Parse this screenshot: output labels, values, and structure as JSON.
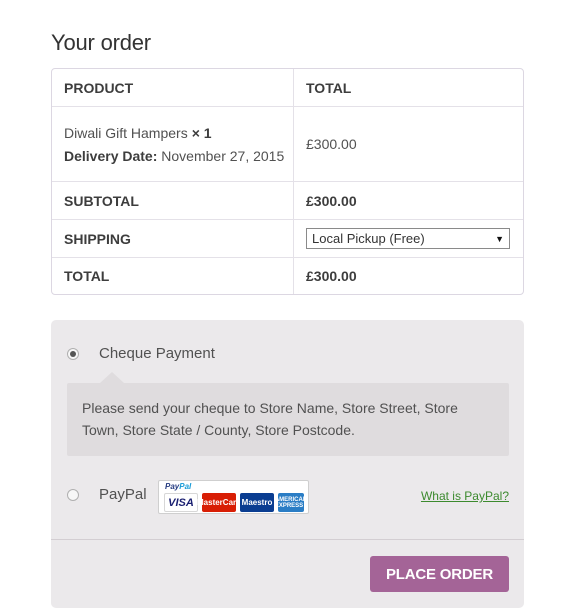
{
  "heading": "Your order",
  "table": {
    "col_product": "PRODUCT",
    "col_total": "TOTAL",
    "item": {
      "name": "Diwali Gift Hampers",
      "qty": "× 1",
      "delivery_label": "Delivery Date:",
      "delivery_value": "November 27, 2015",
      "total": "£300.00"
    },
    "subtotal_label": "SUBTOTAL",
    "subtotal_value": "£300.00",
    "shipping_label": "SHIPPING",
    "shipping_selected": "Local Pickup (Free)",
    "total_label": "TOTAL",
    "total_value": "£300.00"
  },
  "payment": {
    "cheque_label": "Cheque Payment",
    "cheque_selected": true,
    "cheque_description": "Please send your cheque to Store Name, Store Street, Store Town, Store State / County, Store Postcode.",
    "paypal_label": "PayPal",
    "paypal_logo": {
      "brand_pay": "Pay",
      "brand_pal": "Pal",
      "cards": [
        "VISA",
        "MasterCard",
        "Maestro",
        "AMERICAN EXPRESS"
      ]
    },
    "what_is_paypal": "What is PayPal?",
    "place_order": "PLACE ORDER"
  },
  "colors": {
    "accent_button": "#a46497",
    "payment_bg": "#ebe9eb",
    "link": "#3c8a2e"
  }
}
